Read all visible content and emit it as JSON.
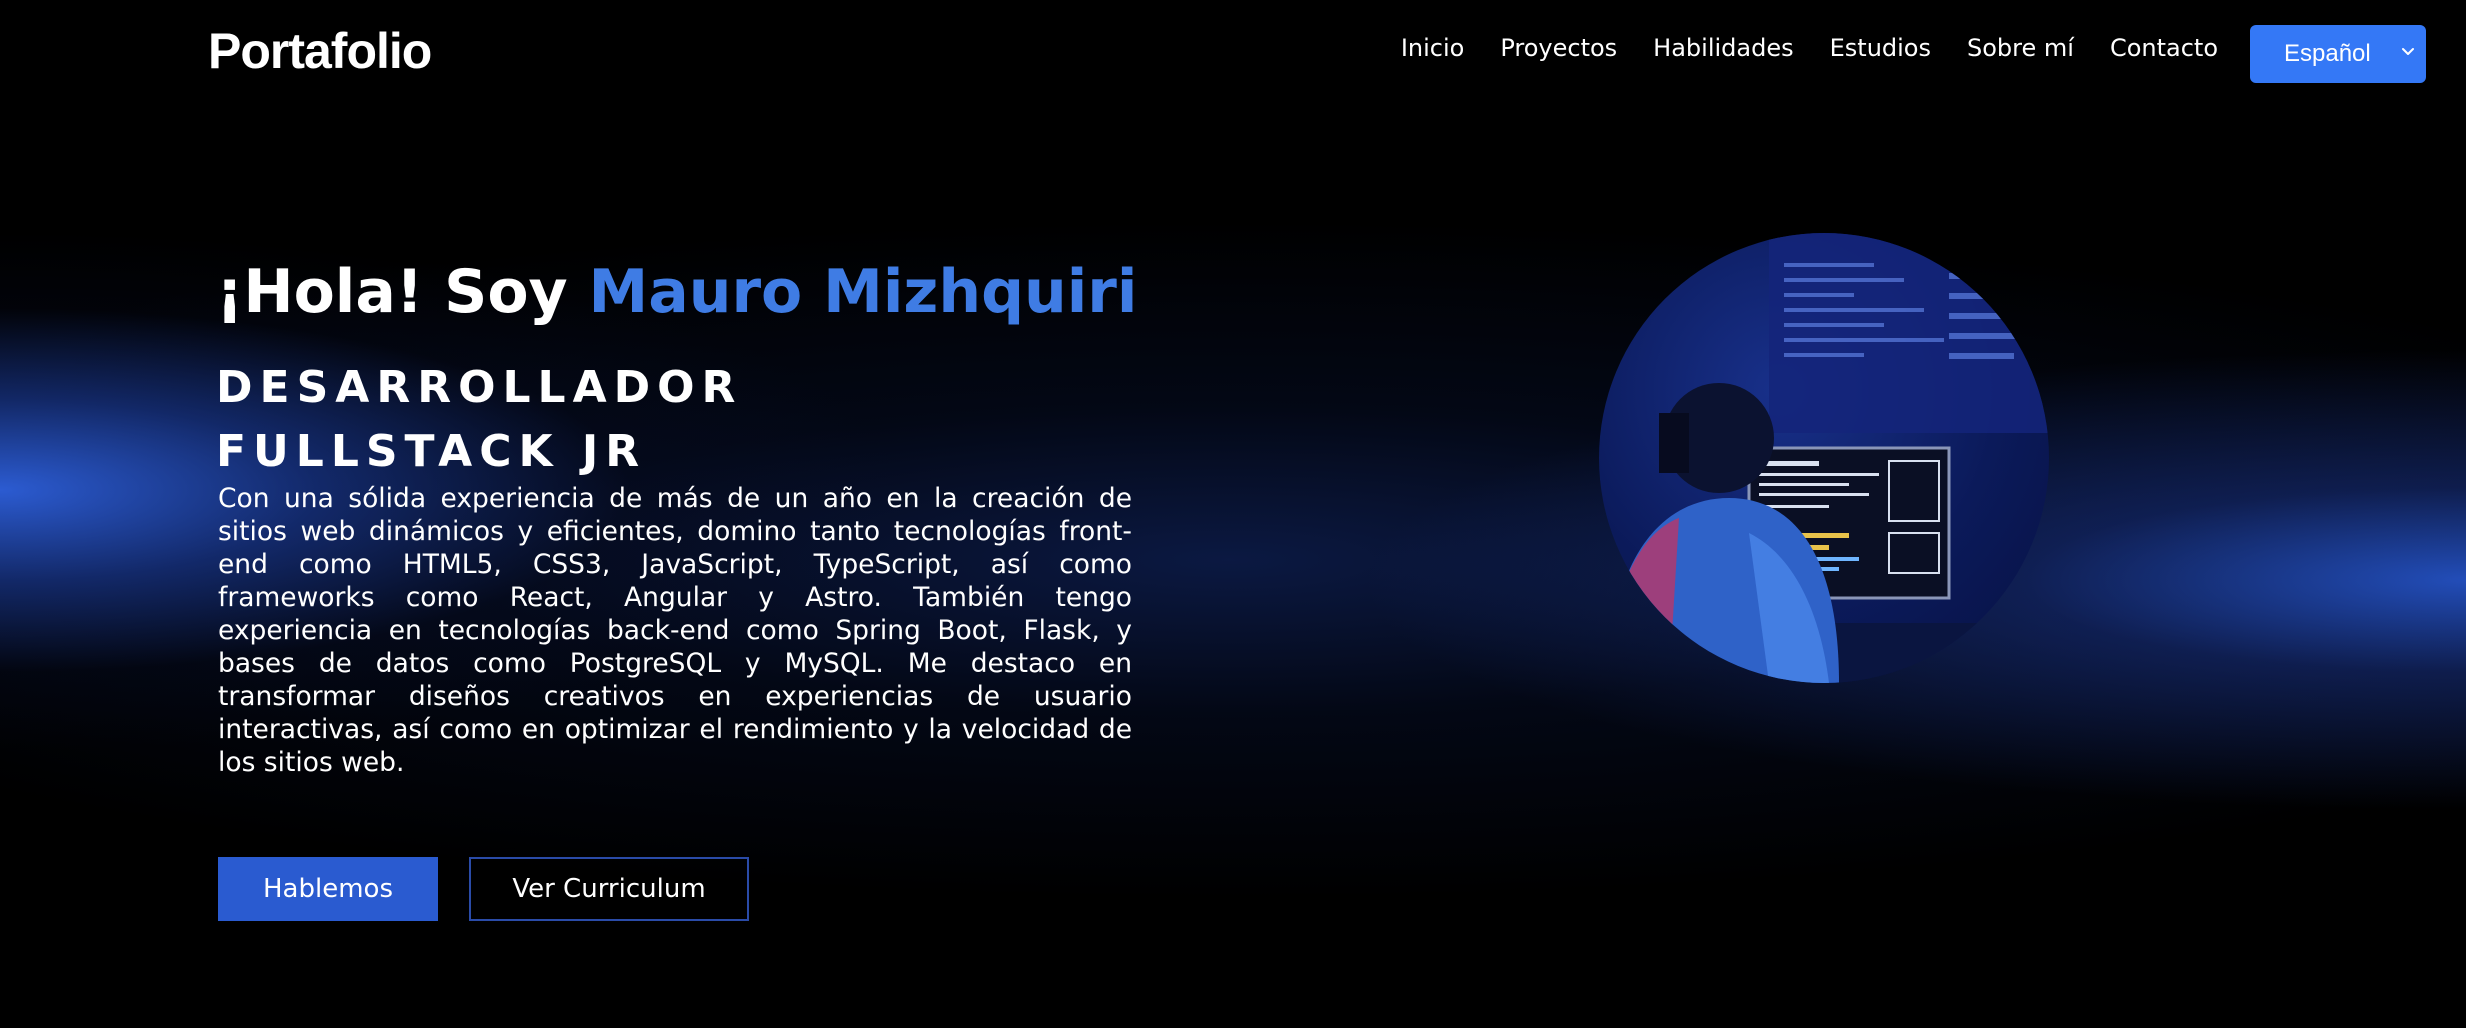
{
  "nav": {
    "brand": "Portafolio",
    "links": [
      "Inicio",
      "Proyectos",
      "Habilidades",
      "Estudios",
      "Sobre mí",
      "Contacto"
    ],
    "language": "Español"
  },
  "hero": {
    "greeting": "¡Hola! Soy ",
    "name": "Mauro Mizhquiri",
    "role_line1": "DESARROLLADOR",
    "role_line2": "FULLSTACK JR",
    "description": "Con una sólida experiencia de más de un año en la creación de sitios web dinámicos y eficientes, domino tanto tecnologías front-end como HTML5, CSS3, JavaScript, TypeScript, así como frameworks como React, Angular y Astro. También tengo experiencia en tecnologías back-end como Spring Boot, Flask, y bases de datos como PostgreSQL y MySQL. Me destaco en transformar diseños creativos en experiencias de usuario interactivas, así como en optimizar el rendimiento y la velocidad de los sitios web.",
    "primary_button": "Hablemos",
    "secondary_button": "Ver Curriculum"
  },
  "colors": {
    "background": "#000000",
    "accent": "#3f7ce4",
    "button_primary": "#2a5bd0",
    "language_select": "#3478f6"
  },
  "icons": {
    "language_select": "chevron-down-icon",
    "portrait": "developer-at-computer-photo"
  }
}
